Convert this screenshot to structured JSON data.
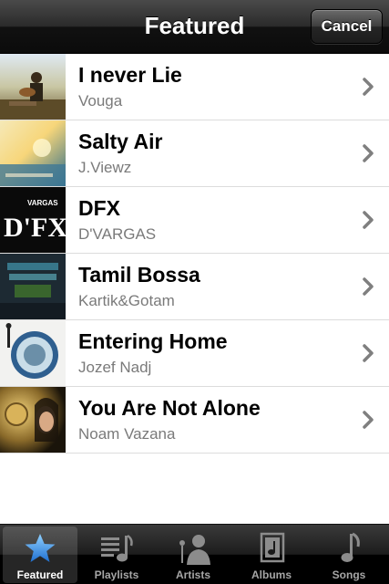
{
  "navbar": {
    "title": "Featured",
    "cancel_label": "Cancel"
  },
  "rows": [
    {
      "title": "I never Lie",
      "artist": "Vouga"
    },
    {
      "title": "Salty Air",
      "artist": "J.Viewz"
    },
    {
      "title": "DFX",
      "artist": "D'VARGAS"
    },
    {
      "title": "Tamil Bossa",
      "artist": "Kartik&Gotam"
    },
    {
      "title": "Entering Home",
      "artist": "Jozef Nadj"
    },
    {
      "title": "You Are Not Alone",
      "artist": "Noam Vazana"
    }
  ],
  "tabs": [
    {
      "label": "Featured",
      "icon": "star-icon"
    },
    {
      "label": "Playlists",
      "icon": "playlists-icon"
    },
    {
      "label": "Artists",
      "icon": "artists-icon"
    },
    {
      "label": "Albums",
      "icon": "albums-icon"
    },
    {
      "label": "Songs",
      "icon": "songs-icon"
    }
  ],
  "cover_art_text": {
    "dfx": "D'FX",
    "dfx_small": "VARGAS"
  },
  "colors": {
    "selected_tab_icon": "#3b8fe6",
    "tab_icon": "#8c8c8c",
    "subtitle": "#7a7a7a"
  }
}
